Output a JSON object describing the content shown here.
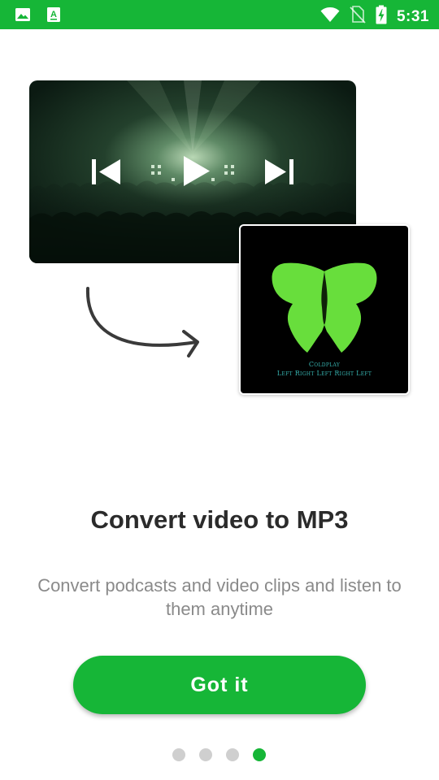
{
  "colors": {
    "accent": "#16b637",
    "headline": "#2b2b2b",
    "subtext": "#8a8a8a"
  },
  "status_bar": {
    "time": "5:31",
    "icons": [
      "image-icon",
      "a-notification-icon",
      "wifi-icon",
      "no-sim-icon",
      "battery-charging-icon"
    ]
  },
  "illustration": {
    "video_controls": [
      "skip-previous-icon",
      "play-icon",
      "skip-next-icon"
    ],
    "album": {
      "artist": "Coldplay",
      "title": "Left Right Left Right Left"
    }
  },
  "onboarding": {
    "title": "Convert video to MP3",
    "description": "Convert podcasts and video clips and listen to them anytime",
    "button_label": "Got it",
    "page_count": 4,
    "current_page": 4
  }
}
